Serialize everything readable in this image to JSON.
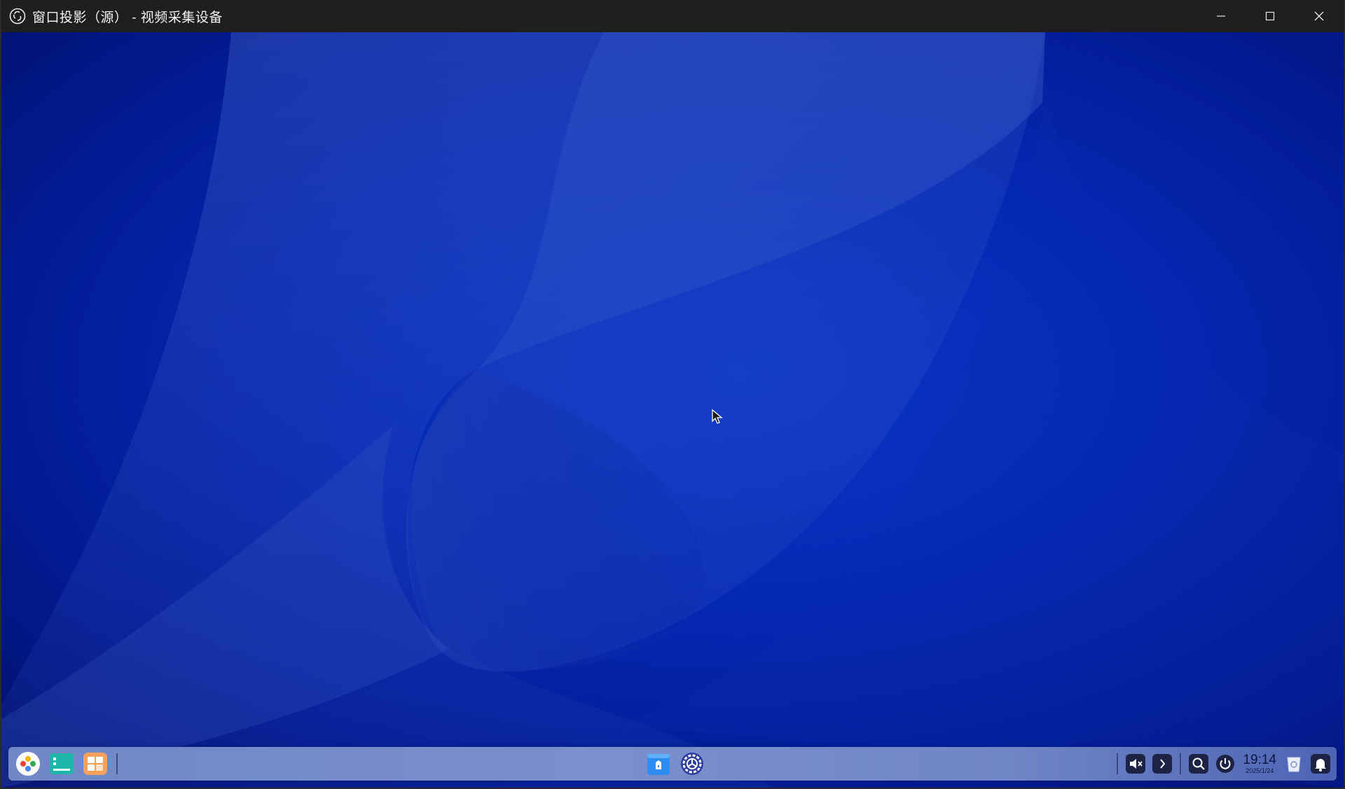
{
  "window": {
    "title": "窗口投影（源） - 视频采集设备",
    "controls": {
      "minimize_icon": "minimize-icon",
      "maximize_icon": "maximize-icon",
      "close_icon": "close-icon"
    }
  },
  "desktop": {
    "wallpaper_colors": [
      "#020f6a",
      "#0528b3",
      "#2b4fb8"
    ]
  },
  "taskbar": {
    "left_items": [
      {
        "name": "launcher-icon"
      },
      {
        "name": "multitask-view-icon"
      },
      {
        "name": "workspace-icon"
      }
    ],
    "pinned_apps": [
      {
        "name": "app-store-icon"
      },
      {
        "name": "settings-icon"
      }
    ],
    "tray": {
      "volume_icon": "volume-muted-icon",
      "expand_icon": "chevron-right-icon",
      "search_icon": "search-icon",
      "power_icon": "power-icon",
      "trash_icon": "trash-icon",
      "notification_icon": "bell-icon"
    },
    "clock": {
      "time": "19:14",
      "date": "2025/1/24"
    }
  }
}
